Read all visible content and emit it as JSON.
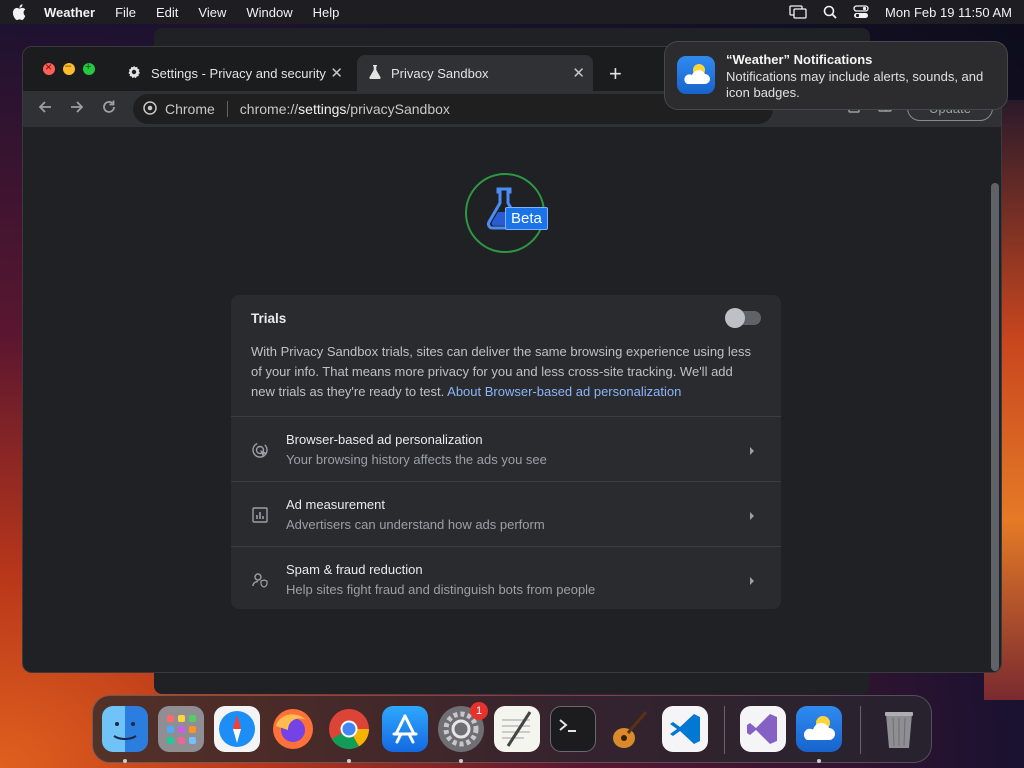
{
  "menubar": {
    "app_name": "Weather",
    "items": [
      "File",
      "Edit",
      "View",
      "Window",
      "Help"
    ],
    "clock": "Mon Feb 19  11:50 AM"
  },
  "browser": {
    "tabs": [
      {
        "title": "Settings - Privacy and security",
        "icon": "gear-icon",
        "active": false
      },
      {
        "title": "Privacy Sandbox",
        "icon": "flask-icon",
        "active": true
      }
    ],
    "omnibox": {
      "site_label": "Chrome",
      "url_prefix": "chrome://",
      "url_bold": "settings",
      "url_suffix": "/privacySandbox"
    },
    "update_label": "Update"
  },
  "page": {
    "badge_label": "Beta",
    "card": {
      "title": "Trials",
      "toggle_on": false,
      "description": "With Privacy Sandbox trials, sites can deliver the same browsing experience using less of your info. That means more privacy for you and less cross-site tracking. We'll add new trials as they're ready to test.",
      "link": "About Browser-based ad personalization",
      "rows": [
        {
          "title": "Browser-based ad personalization",
          "subtitle": "Your browsing history affects the ads you see",
          "icon": "ad-targeting-icon"
        },
        {
          "title": "Ad measurement",
          "subtitle": "Advertisers can understand how ads perform",
          "icon": "bar-chart-icon"
        },
        {
          "title": "Spam & fraud reduction",
          "subtitle": "Help sites fight fraud and distinguish bots from people",
          "icon": "person-shield-icon"
        }
      ]
    }
  },
  "notification": {
    "title": "“Weather” Notifications",
    "body": "Notifications may include alerts, sounds, and icon badges."
  },
  "dock": {
    "apps": [
      "Finder",
      "Launchpad",
      "Safari",
      "Firefox",
      "Chrome",
      "App Store",
      "System Settings",
      "TextEdit",
      "Terminal",
      "GarageBand",
      "Visual Studio Code",
      "Visual Studio",
      "Weather",
      "Trash"
    ],
    "settings_badge": "1"
  },
  "colors": {
    "accent": "#8ab4f8",
    "beta_blue": "#1a73e8",
    "logo_ring": "#2b9a44"
  }
}
